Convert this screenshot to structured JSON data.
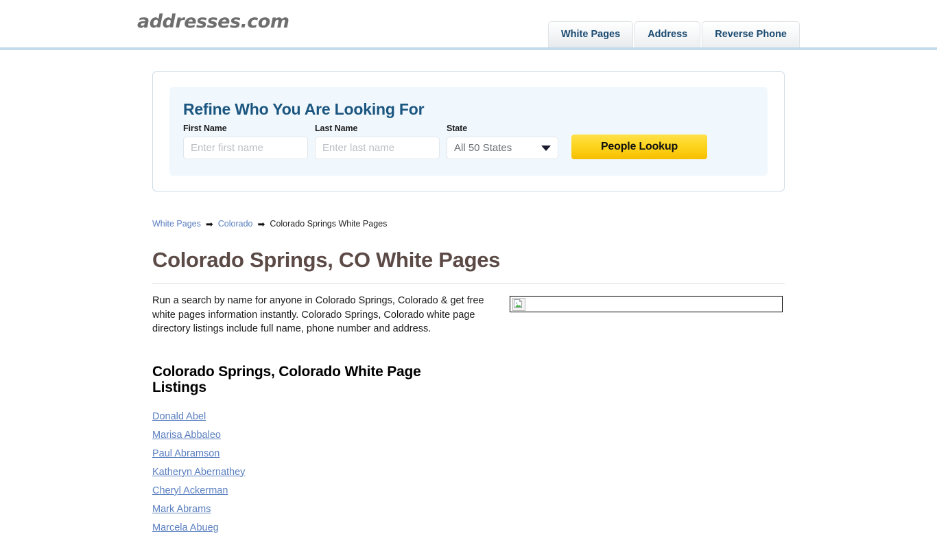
{
  "header": {
    "logo": "addresses.com",
    "tabs": [
      {
        "label": "White Pages",
        "active": true
      },
      {
        "label": "Address",
        "active": false
      },
      {
        "label": "Reverse Phone",
        "active": false
      }
    ]
  },
  "refine": {
    "title": "Refine Who You Are Looking For",
    "first_name": {
      "label": "First Name",
      "placeholder": "Enter first name",
      "value": ""
    },
    "last_name": {
      "label": "Last Name",
      "placeholder": "Enter last name",
      "value": ""
    },
    "state": {
      "label": "State",
      "selected": "All 50 States"
    },
    "submit_label": "People Lookup"
  },
  "breadcrumb": {
    "items": [
      {
        "label": "White Pages",
        "link": true
      },
      {
        "label": "Colorado",
        "link": true
      },
      {
        "label": "Colorado Springs White Pages",
        "link": false
      }
    ],
    "separator": "➡"
  },
  "main": {
    "page_title": "Colorado Springs, CO White Pages",
    "intro": "Run a search by name for anyone in Colorado Springs, Colorado & get free white pages information instantly. Colorado Springs, Colorado white page directory listings include full name, phone number and address.",
    "ad_slot": {
      "icon": "broken-image-icon"
    },
    "listings_title": "Colorado Springs, Colorado White Page Listings",
    "listings": [
      "Donald Abel",
      "Marisa Abbaleo",
      "Paul Abramson",
      "Katheryn Abernathey",
      "Cheryl Ackerman",
      "Mark Abrams",
      "Marcela Abueg"
    ]
  },
  "colors": {
    "header_rule": "#c3dbea",
    "tab_text": "#1b4a70",
    "panel_bg": "#f1f8fd",
    "refine_title": "#1b5680",
    "button": "#fdd51f",
    "link": "#5a7fc0",
    "page_title": "#5b4a46"
  }
}
